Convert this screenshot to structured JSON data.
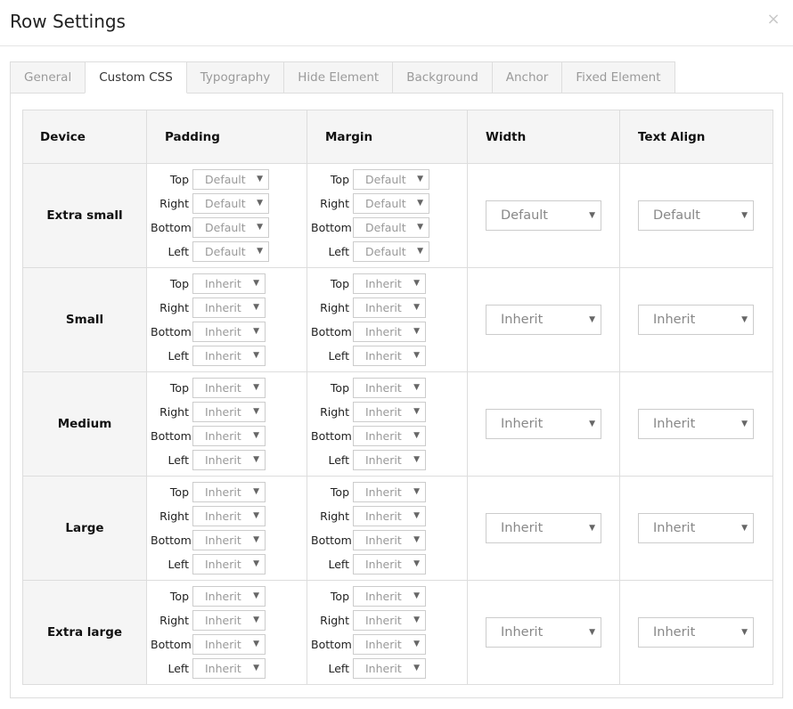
{
  "dialog": {
    "title": "Row Settings",
    "close_symbol": "×"
  },
  "tabs": [
    {
      "label": "General",
      "active": false
    },
    {
      "label": "Custom CSS",
      "active": true
    },
    {
      "label": "Typography",
      "active": false
    },
    {
      "label": "Hide Element",
      "active": false
    },
    {
      "label": "Background",
      "active": false
    },
    {
      "label": "Anchor",
      "active": false
    },
    {
      "label": "Fixed Element",
      "active": false
    }
  ],
  "table": {
    "headers": {
      "device": "Device",
      "padding": "Padding",
      "margin": "Margin",
      "width": "Width",
      "text_align": "Text Align"
    },
    "side_labels": [
      "Top",
      "Right",
      "Bottom",
      "Left"
    ],
    "rows": [
      {
        "device": "Extra small",
        "padding": [
          "Default",
          "Default",
          "Default",
          "Default"
        ],
        "margin": [
          "Default",
          "Default",
          "Default",
          "Default"
        ],
        "width": "Default",
        "text_align": "Default"
      },
      {
        "device": "Small",
        "padding": [
          "Inherit",
          "Inherit",
          "Inherit",
          "Inherit"
        ],
        "margin": [
          "Inherit",
          "Inherit",
          "Inherit",
          "Inherit"
        ],
        "width": "Inherit",
        "text_align": "Inherit"
      },
      {
        "device": "Medium",
        "padding": [
          "Inherit",
          "Inherit",
          "Inherit",
          "Inherit"
        ],
        "margin": [
          "Inherit",
          "Inherit",
          "Inherit",
          "Inherit"
        ],
        "width": "Inherit",
        "text_align": "Inherit"
      },
      {
        "device": "Large",
        "padding": [
          "Inherit",
          "Inherit",
          "Inherit",
          "Inherit"
        ],
        "margin": [
          "Inherit",
          "Inherit",
          "Inherit",
          "Inherit"
        ],
        "width": "Inherit",
        "text_align": "Inherit"
      },
      {
        "device": "Extra large",
        "padding": [
          "Inherit",
          "Inherit",
          "Inherit",
          "Inherit"
        ],
        "margin": [
          "Inherit",
          "Inherit",
          "Inherit",
          "Inherit"
        ],
        "width": "Inherit",
        "text_align": "Inherit"
      }
    ]
  },
  "icons": {
    "close": "close-icon",
    "dropdown": "caret-down-icon"
  },
  "colors": {
    "border": "#dddddd",
    "header_bg": "#f5f5f5",
    "tab_inactive_text": "#9a9a9a",
    "select_text": "#999999"
  }
}
